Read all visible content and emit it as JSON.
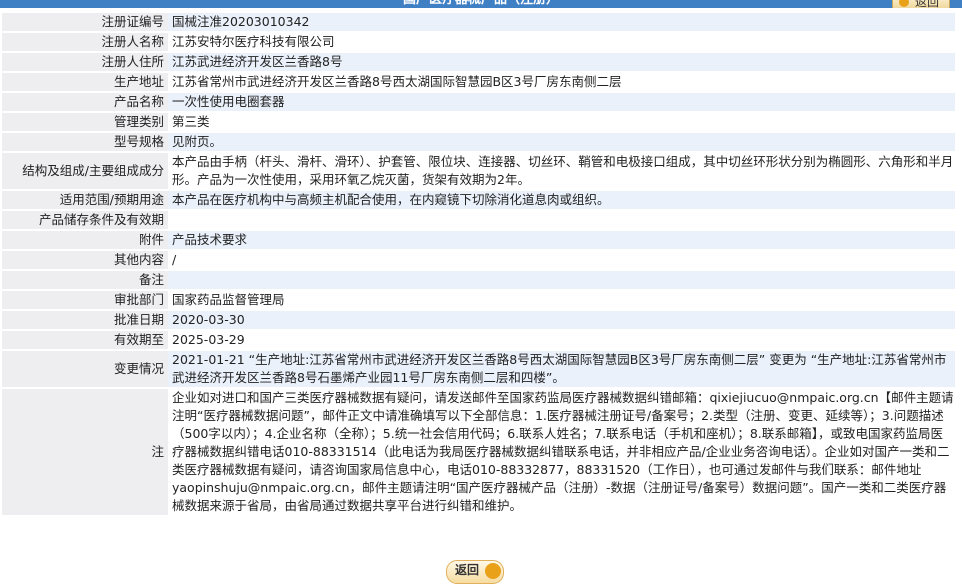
{
  "header": {
    "title": "国产医疗器械产品（注册）",
    "back_label": "返回"
  },
  "fields": [
    {
      "label": "注册证编号",
      "value": "国械注准20203010342"
    },
    {
      "label": "注册人名称",
      "value": "江苏安特尔医疗科技有限公司"
    },
    {
      "label": "注册人住所",
      "value": "江苏武进经济开发区兰香路8号"
    },
    {
      "label": "生产地址",
      "value": "江苏省常州市武进经济开发区兰香路8号西太湖国际智慧园B区3号厂房东南侧二层"
    },
    {
      "label": "产品名称",
      "value": "一次性使用电圈套器"
    },
    {
      "label": "管理类别",
      "value": "第三类"
    },
    {
      "label": "型号规格",
      "value": "见附页。"
    },
    {
      "label": "结构及组成/主要组成成分",
      "value": "本产品由手柄（杆头、滑杆、滑环）、护套管、限位块、连接器、切丝环、鞘管和电极接口组成，其中切丝环形状分别为椭圆形、六角形和半月形。产品为一次性使用，采用环氧乙烷灭菌，货架有效期为2年。"
    },
    {
      "label": "适用范围/预期用途",
      "value": "本产品在医疗机构中与高频主机配合使用，在内窥镜下切除消化道息肉或组织。"
    },
    {
      "label": "产品储存条件及有效期",
      "value": ""
    },
    {
      "label": "附件",
      "value": "产品技术要求"
    },
    {
      "label": "其他内容",
      "value": "/"
    },
    {
      "label": "备注",
      "value": ""
    },
    {
      "label": "审批部门",
      "value": "国家药品监督管理局"
    },
    {
      "label": "批准日期",
      "value": "2020-03-30"
    },
    {
      "label": "有效期至",
      "value": "2025-03-29"
    },
    {
      "label": "变更情况",
      "value": "2021-01-21 “生产地址:江苏省常州市武进经济开发区兰香路8号西太湖国际智慧园B区3号厂房东南侧二层” 变更为 “生产地址:江苏省常州市武进经济开发区兰香路8号石墨烯产业园11号厂房东南侧二层和四楼”。"
    }
  ],
  "note": {
    "label": "注",
    "p1": "企业如对进口和国产三类医疗器械数据有疑问，请发送邮件至国家药监局医疗器械数据纠错邮箱：qixiejiucuo@nmpaic.org.cn【邮件主题请注明“医疗器械数据问题”，邮件正文中请准确填写以下全部信息：1.医疗器械注册证号/备案号；2.类型（注册、变更、延续等）；3.问题描述（500字以内）；4.企业名称（全称）；5.统一社会信用代码；6.联系人姓名；7.联系电话（手机和座机）；8.联系邮箱】，或致电国家药监局医疗器械数据纠错电话010-88331514（此电话为我局医疗器械数据纠错联系电话，并非相应产品/企业业务咨询电话）。企业如对国产一类和二类医疗器械数据有疑问，请咨询国家局信息中心，电话010-88332877，88331520（工作日），也可通过发邮件与我们联系：邮件地址yaopinshuju@nmpaic.org.cn，邮件主题请注明“国产医疗器械产品（注册）-数据（注册证号/备案号）数据问题”。国产一类和二类医疗器械数据来源于省局，由省局通过数据共享平台进行纠错和维护。"
  },
  "footer": {
    "back_label": "返回"
  }
}
